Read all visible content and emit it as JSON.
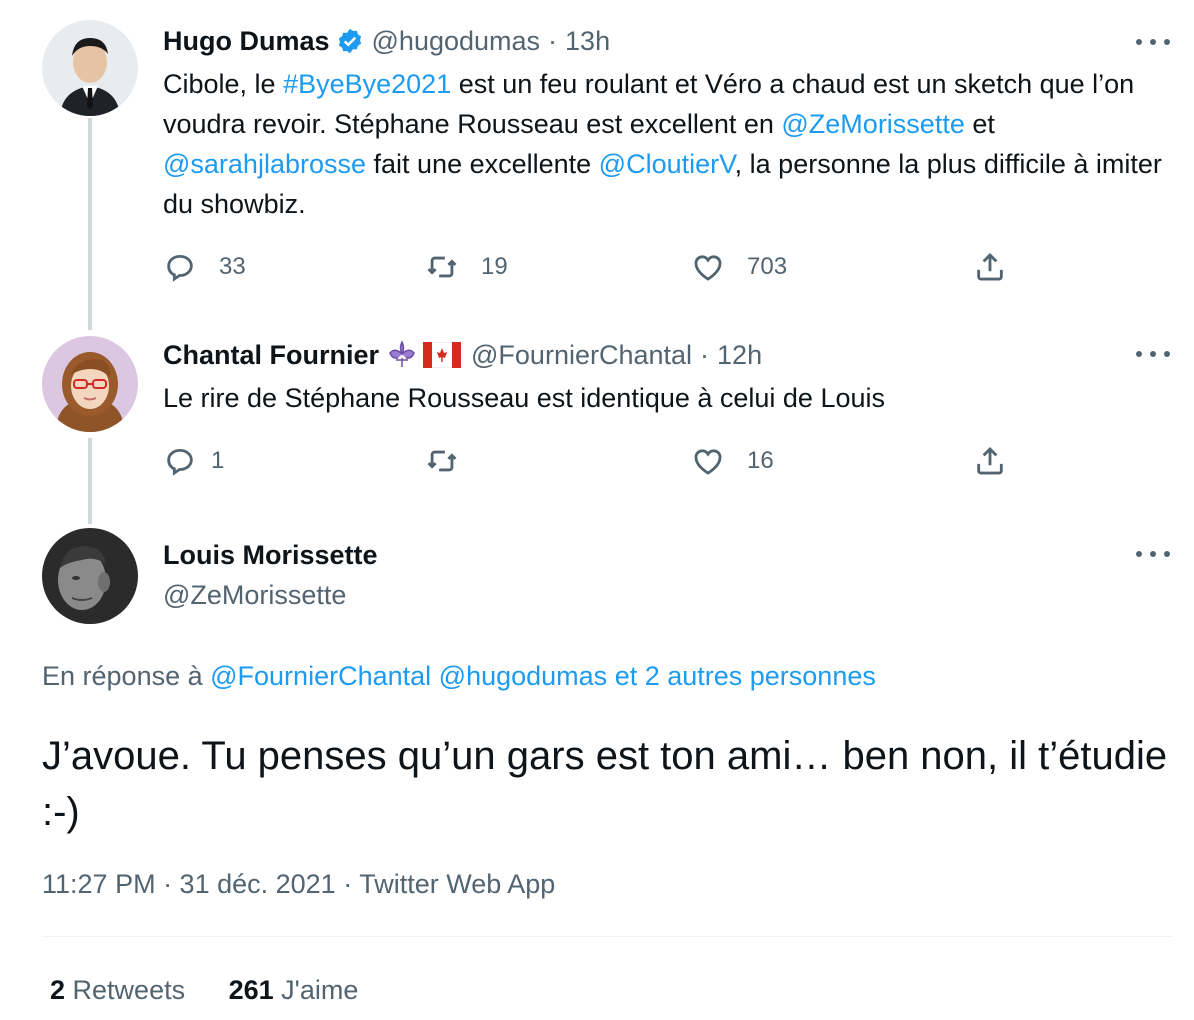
{
  "tweets": [
    {
      "name": "Hugo Dumas",
      "handle": "@hugodumas",
      "dot": "·",
      "time": "13h",
      "text_parts": [
        "Cibole, le ",
        "#ByeBye2021",
        " est un feu roulant et Véro a chaud est un sketch que l’on voudra revoir. Stéphane Rousseau est excellent en ",
        "@ZeMorissette",
        " et ",
        "@sarahjlabrosse",
        " fait une excellente ",
        "@CloutierV",
        ", la personne la plus difficile à imiter du showbiz."
      ],
      "replies": "33",
      "retweets": "19",
      "likes": "703",
      "verified_icon": "verified-badge-icon"
    },
    {
      "name": "Chantal Fournier",
      "emoji": "⚜️🇨🇦",
      "handle": "@FournierChantal",
      "dot": "·",
      "time": "12h",
      "text": "Le rire de Stéphane Rousseau est identique à celui de Louis",
      "replies": "1",
      "retweets": "",
      "likes": "16"
    }
  ],
  "main": {
    "name": "Louis Morissette",
    "handle": "@ZeMorissette",
    "reply_prefix": "En réponse à ",
    "reply_handle1": "@FournierChantal",
    "reply_handle2": "@hugodumas",
    "reply_others": " et 2 autres personnes",
    "text": "J’avoue. Tu penses qu’un gars est ton ami… ben non, il t’étudie :-)",
    "meta": "11:27 PM · 31 déc. 2021 · Twitter Web App",
    "retweets_count": "2",
    "retweets_label": " Retweets",
    "likes_count": "261",
    "likes_label": " J'aime"
  },
  "colors": {
    "accent": "#1d9bf0",
    "muted": "#536471",
    "text": "#0f1419",
    "line": "#cfd9de"
  },
  "icons": [
    "reply-icon",
    "retweet-icon",
    "like-icon",
    "share-icon",
    "more-icon",
    "verified-badge-icon"
  ]
}
